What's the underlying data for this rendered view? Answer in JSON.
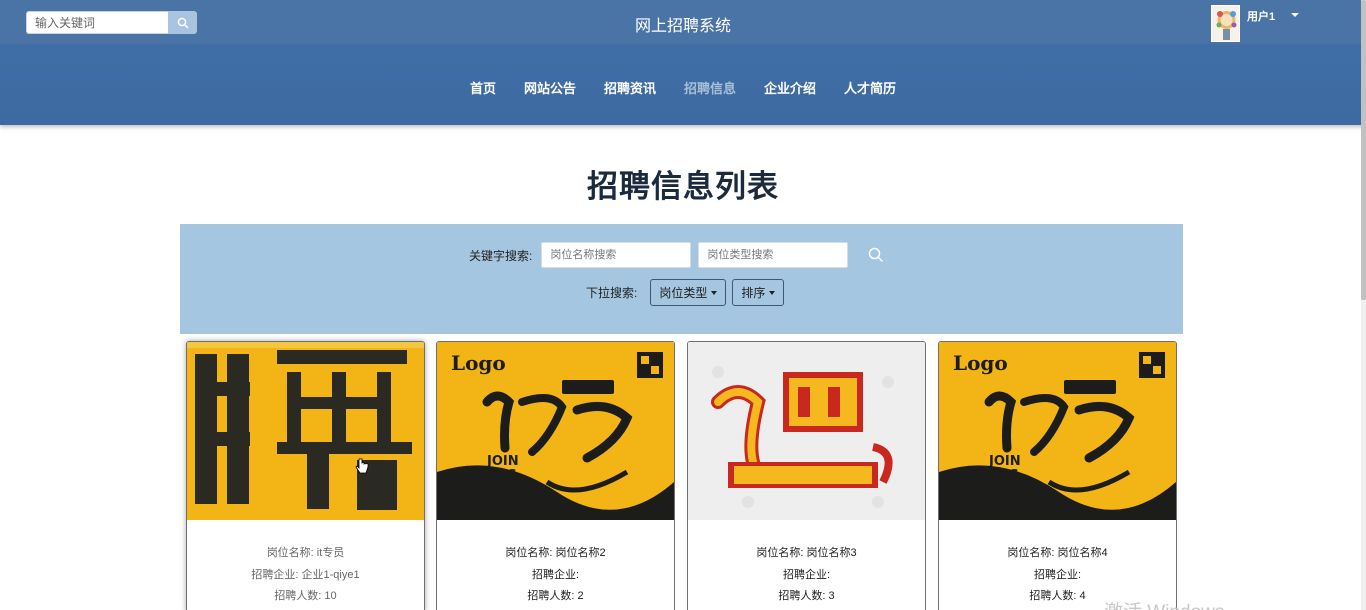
{
  "header": {
    "search_placeholder": "输入关键词",
    "site_title": "网上招聘系统",
    "username": "用户1"
  },
  "nav": {
    "items": [
      {
        "label": "首页",
        "active": false
      },
      {
        "label": "网站公告",
        "active": false
      },
      {
        "label": "招聘资讯",
        "active": false
      },
      {
        "label": "招聘信息",
        "active": true
      },
      {
        "label": "企业介绍",
        "active": false
      },
      {
        "label": "人才简历",
        "active": false
      }
    ]
  },
  "page": {
    "heading": "招聘信息列表"
  },
  "filter": {
    "keyword_label": "关键字搜索:",
    "position_name_placeholder": "岗位名称搜索",
    "position_type_placeholder": "岗位类型搜索",
    "dropdown_label": "下拉搜索:",
    "type_dropdown": "岗位类型",
    "sort_dropdown": "排序"
  },
  "cards": [
    {
      "name_line": "岗位名称: it专员",
      "company_line": "招聘企业: 企业1-qiye1",
      "count_line": "招聘人数: 10",
      "image": "yellow-pin-poster"
    },
    {
      "name_line": "岗位名称: 岗位名称2",
      "company_line": "招聘企业:",
      "count_line": "招聘人数: 2",
      "image": "logo-join-us-poster"
    },
    {
      "name_line": "岗位名称: 岗位名称3",
      "company_line": "招聘企业:",
      "count_line": "招聘人数: 3",
      "image": "ji-pin-poster"
    },
    {
      "name_line": "岗位名称: 岗位名称4",
      "company_line": "招聘企业:",
      "count_line": "招聘人数: 4",
      "image": "logo-join-us-poster"
    }
  ],
  "watermark": "激活 Windows",
  "colors": {
    "topbar": "#4a73a6",
    "navbar": "#3f6ea6",
    "filter_panel": "#a5c6e1",
    "poster_yellow": "#f2b515"
  }
}
